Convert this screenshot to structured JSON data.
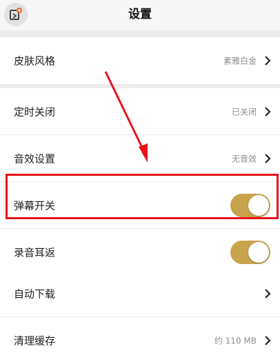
{
  "header": {
    "title": "设置"
  },
  "groups": [
    {
      "rows": [
        {
          "label": "皮肤风格",
          "value": "素雅白金"
        }
      ]
    },
    {
      "rows": [
        {
          "label": "定时关闭",
          "value": "已关闭"
        },
        {
          "label": "音效设置",
          "value": "无音效"
        },
        {
          "label": "弹幕开关",
          "toggle_on": true
        },
        {
          "label": "录音耳返",
          "toggle_on": true
        }
      ]
    },
    {
      "rows": [
        {
          "label": "自动下载",
          "value": ""
        },
        {
          "label": "清理缓存",
          "value": "约 110 MB"
        }
      ]
    }
  ],
  "colors": {
    "toggle_on": "#c9a24c",
    "annotation_red": "#e8121b",
    "back_badge": "#f26522"
  },
  "icons": {
    "back": "back-icon",
    "chevron": "chevron-right-icon"
  }
}
